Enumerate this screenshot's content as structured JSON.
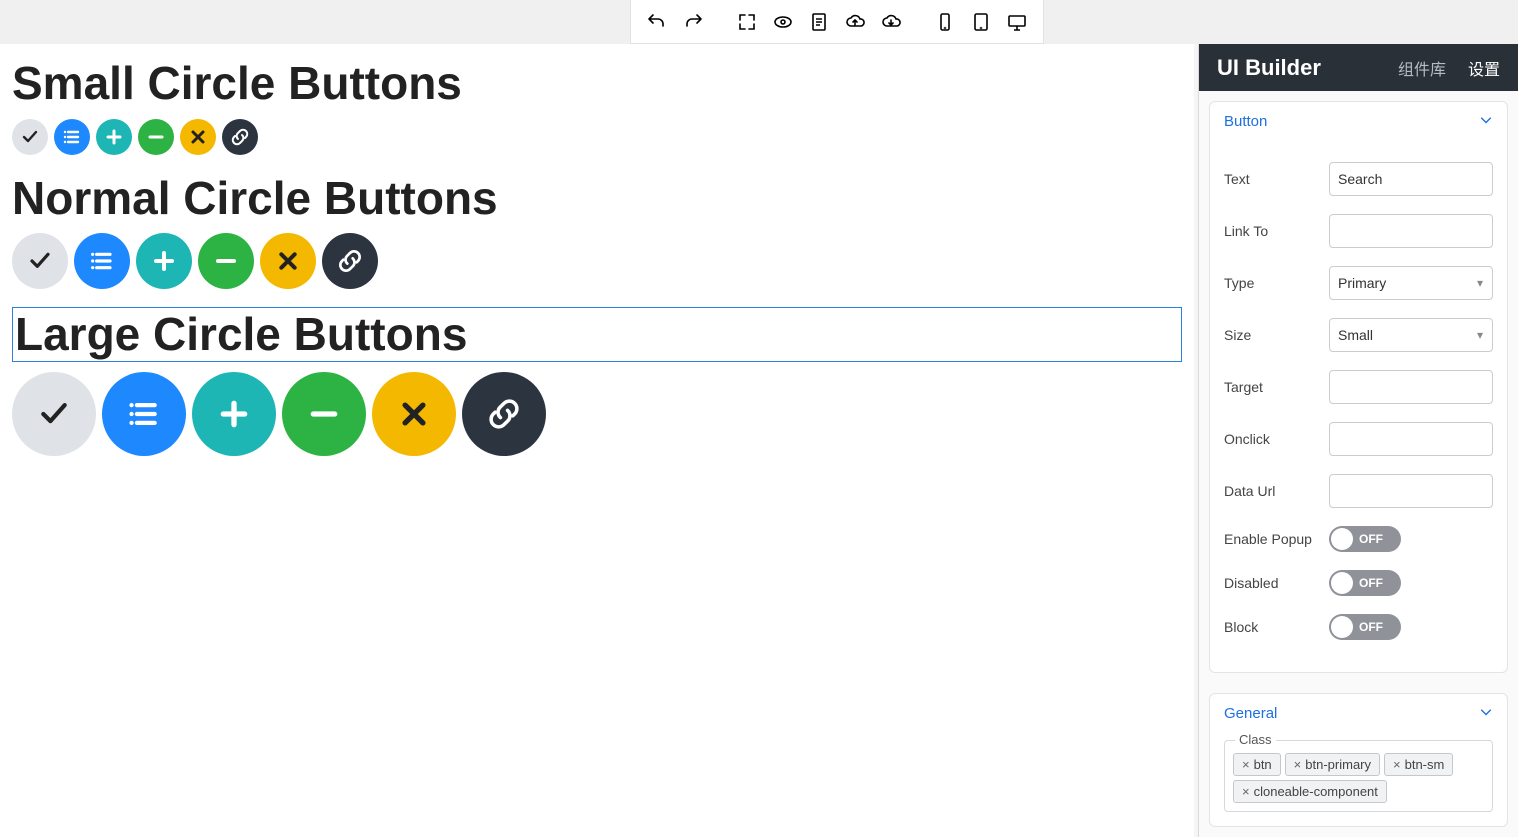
{
  "topbar": {
    "icons": {
      "undo": "undo-icon",
      "redo": "redo-icon",
      "fullscreen": "fullscreen-icon",
      "preview": "preview-icon",
      "document": "document-icon",
      "cloud_up": "cloud-upload-icon",
      "cloud_down": "cloud-download-icon",
      "phone": "phone-icon",
      "tablet": "tablet-icon",
      "desktop": "desktop-icon"
    }
  },
  "canvas": {
    "sections": {
      "small_title": "Small Circle Buttons",
      "normal_title": "Normal Circle Buttons",
      "large_title": "Large Circle Buttons"
    },
    "selected_section": "large",
    "button_variants": [
      {
        "name": "check",
        "color": "c-default",
        "icon": "check-icon"
      },
      {
        "name": "list",
        "color": "c-primary",
        "icon": "list-icon"
      },
      {
        "name": "plus",
        "color": "c-info",
        "icon": "plus-icon"
      },
      {
        "name": "minus",
        "color": "c-success",
        "icon": "minus-icon"
      },
      {
        "name": "times",
        "color": "c-warning",
        "icon": "times-icon"
      },
      {
        "name": "link",
        "color": "c-dark",
        "icon": "link-icon"
      }
    ]
  },
  "sidebar": {
    "brand": "UI Builder",
    "tabs": {
      "components": "组件库",
      "settings": "设置"
    },
    "active_tab": "settings",
    "button_panel": {
      "title": "Button",
      "props": {
        "text_lbl": "Text",
        "text_val": "Search",
        "link_lbl": "Link To",
        "link_val": "",
        "type_lbl": "Type",
        "type_val": "Primary",
        "size_lbl": "Size",
        "size_val": "Small",
        "target_lbl": "Target",
        "target_val": "",
        "onclick_lbl": "Onclick",
        "onclick_val": "",
        "dataurl_lbl": "Data Url",
        "dataurl_val": "",
        "popup_lbl": "Enable Popup",
        "popup_val": "OFF",
        "disabled_lbl": "Disabled",
        "disabled_val": "OFF",
        "block_lbl": "Block",
        "block_val": "OFF"
      }
    },
    "general_panel": {
      "title": "General",
      "class_lbl": "Class",
      "classes": [
        "btn",
        "btn-primary",
        "btn-sm",
        "cloneable-component"
      ]
    }
  }
}
